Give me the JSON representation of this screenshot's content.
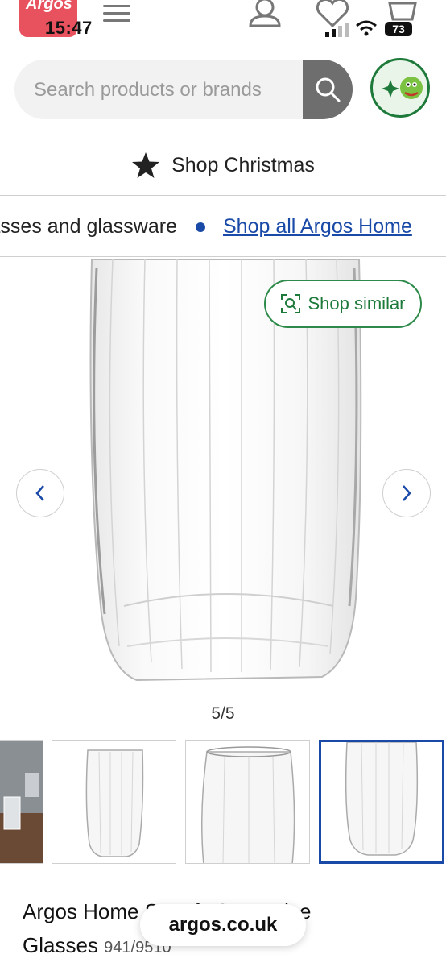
{
  "status_bar": {
    "time": "15:47",
    "battery": "73"
  },
  "brand": {
    "logo_text": "Argos"
  },
  "search": {
    "placeholder": "Search products or brands"
  },
  "promo": {
    "shop_christmas_label": "Shop Christmas"
  },
  "breadcrumb": {
    "previous": "Glasses and glassware",
    "link": "Shop all Argos Home"
  },
  "gallery": {
    "shop_similar_label": "Shop similar",
    "counter": "5/5",
    "thumbnails": [
      "thumb-1",
      "thumb-2",
      "thumb-3",
      "thumb-4"
    ]
  },
  "product": {
    "title_line1": "Argos Home Set of 10 Beatrice",
    "title_line2": "Glasses",
    "sku": "941/9510"
  },
  "browser": {
    "url": "argos.co.uk"
  },
  "colors": {
    "accent_green": "#1e7a3a",
    "link_blue": "#1a4aa8",
    "brand_red": "#e8525e"
  }
}
